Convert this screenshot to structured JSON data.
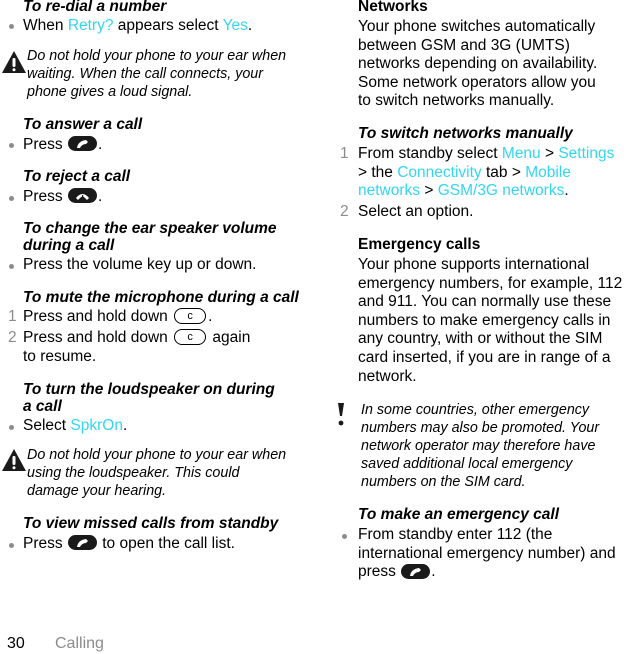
{
  "page": {
    "number": "30",
    "section": "Calling",
    "highlight_color": "#33d6f0"
  },
  "left": {
    "redial": {
      "heading": "To re-dial a number",
      "step_pre": "When ",
      "step_hl1": "Retry?",
      "step_mid": " appears select ",
      "step_hl2": "Yes",
      "step_post": "."
    },
    "warning1": {
      "icon": "warning-triangle-icon",
      "lines": [
        "Do not hold your phone to your ear when",
        "waiting. When the call connects, your",
        "phone gives a loud signal."
      ]
    },
    "answer": {
      "heading": "To answer a call",
      "step_pre": "Press ",
      "step_post": ".",
      "key_icon": "call-key-icon"
    },
    "reject": {
      "heading": "To reject a call",
      "step_pre": "Press ",
      "step_post": ".",
      "key_icon": "end-call-key-icon"
    },
    "volume": {
      "heading_lines": [
        "To change the ear speaker volume",
        "during a call"
      ],
      "step": "Press the volume key up or down."
    },
    "mute": {
      "heading": "To mute the microphone during a call",
      "steps": [
        {
          "num": "1",
          "pre": "Press and hold down ",
          "key": "c",
          "post": "."
        },
        {
          "num": "2",
          "pre": "Press and hold down ",
          "key": "c",
          "post": " again",
          "line2": "to resume."
        }
      ]
    },
    "loudspeaker": {
      "heading_lines": [
        "To turn the loudspeaker on during",
        "a call"
      ],
      "step_pre": "Select ",
      "step_hl": "SpkrOn",
      "step_post": "."
    },
    "warning2": {
      "icon": "warning-triangle-icon",
      "lines": [
        "Do not hold your phone to your ear when",
        "using the loudspeaker. This could",
        "damage your hearing."
      ]
    },
    "missed": {
      "heading": "To view missed calls from standby",
      "step_pre": "Press ",
      "step_post": " to open the call list.",
      "key_icon": "call-key-icon"
    }
  },
  "right": {
    "networks": {
      "heading": "Networks",
      "lines": [
        "Your phone switches automatically",
        "between GSM and 3G (UMTS)",
        "networks depending on availability.",
        "Some network operators allow you",
        "to switch networks manually."
      ]
    },
    "switch": {
      "heading": "To switch networks manually",
      "step1": {
        "num": "1",
        "l1_pre": "From standby select ",
        "l1_hl1": "Menu",
        "l1_sep": " > ",
        "l1_hl2": "Settings",
        "l2_pre": "> the ",
        "l2_hl1": "Connectivity",
        "l2_mid": " tab > ",
        "l2_hl2": "Mobile",
        "l3_hl1": "networks",
        "l3_sep": " > ",
        "l3_hl2": "GSM/3G networks",
        "l3_post": "."
      },
      "step2": {
        "num": "2",
        "text": "Select an option."
      }
    },
    "emergency": {
      "heading": "Emergency calls",
      "lines": [
        "Your phone supports international",
        "emergency numbers, for example, 112",
        "and 911. You can normally use these",
        "numbers to make emergency calls in",
        "any country, with or without the SIM",
        "card inserted, if you are in range of a",
        "network."
      ]
    },
    "note": {
      "icon": "exclamation-icon",
      "lines": [
        "In some countries, other emergency",
        "numbers may also be promoted. Your",
        "network operator may therefore have",
        "saved additional local emergency",
        "numbers on the SIM card."
      ]
    },
    "make_call": {
      "heading": "To make an emergency call",
      "lines": [
        "From standby enter 112 (the",
        "international emergency number) and"
      ],
      "l3_pre": "press ",
      "l3_post": ".",
      "key_icon": "call-key-icon"
    }
  }
}
